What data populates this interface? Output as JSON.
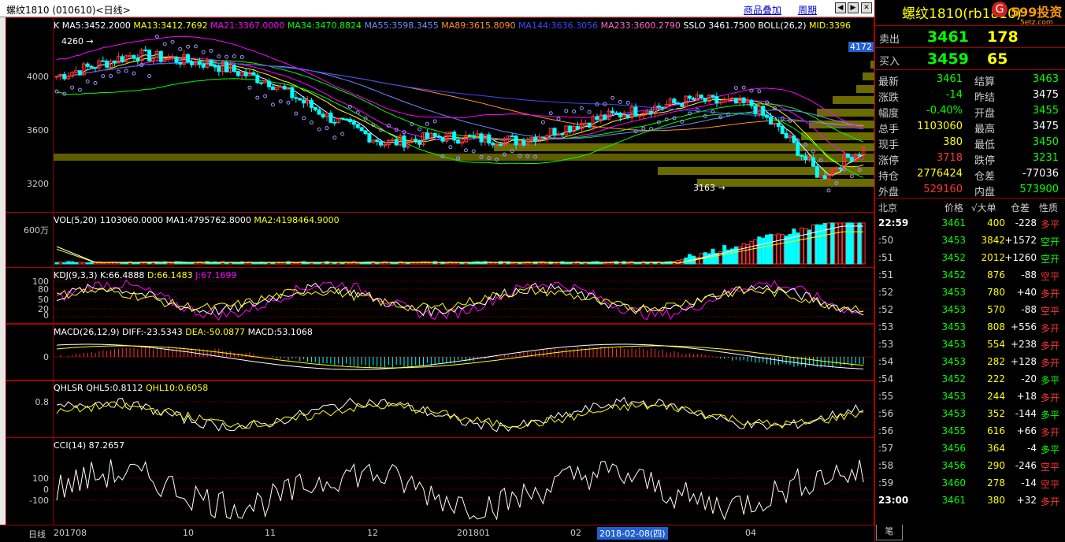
{
  "window": {
    "title": "螺纹1810 (010610)<日线>",
    "overlay_label": "商品叠加",
    "period_label": "周期"
  },
  "instrument": {
    "name": "螺纹1810(rb1810)",
    "brand": "599投资",
    "site": "5etz.com"
  },
  "quotes": [
    {
      "label": "卖出",
      "price": "3461",
      "volume": "178"
    },
    {
      "label": "买入",
      "price": "3459",
      "volume": "65"
    }
  ],
  "stats": [
    {
      "l1": "最新",
      "v1": "3461",
      "c1": "g",
      "l2": "结算",
      "v2": "3463",
      "c2": "g"
    },
    {
      "l1": "涨跌",
      "v1": "-14",
      "c1": "g",
      "l2": "昨结",
      "v2": "3475",
      "c2": "w"
    },
    {
      "l1": "幅度",
      "v1": "-0.40%",
      "c1": "g",
      "l2": "开盘",
      "v2": "3455",
      "c2": "g"
    },
    {
      "l1": "总手",
      "v1": "1103060",
      "c1": "y",
      "l2": "最高",
      "v2": "3475",
      "c2": "w"
    },
    {
      "l1": "现手",
      "v1": "380",
      "c1": "y",
      "l2": "最低",
      "v2": "3450",
      "c2": "g"
    },
    {
      "l1": "涨停",
      "v1": "3718",
      "c1": "r",
      "l2": "跌停",
      "v2": "3231",
      "c2": "g"
    },
    {
      "l1": "持仓",
      "v1": "2776424",
      "c1": "y",
      "l2": "仓差",
      "v2": "-77036",
      "c2": "w"
    },
    {
      "l1": "外盘",
      "v1": "529160",
      "c1": "r",
      "l2": "内盘",
      "v2": "573900",
      "c2": "g"
    }
  ],
  "ticks_header": {
    "time": "北京",
    "price": "价格",
    "vol": "√大单",
    "oi": "仓差",
    "nature": "性质"
  },
  "ticks": [
    {
      "t": "22:59",
      "p": "3461",
      "v": "400",
      "o": "-228",
      "n": "多平",
      "nc": "r",
      "oc": "w"
    },
    {
      "t": ":50",
      "p": "3453",
      "v": "3842",
      "o": "+1572",
      "n": "空开",
      "nc": "g",
      "oc": "w"
    },
    {
      "t": ":51",
      "p": "3452",
      "v": "2012",
      "o": "+1260",
      "n": "空开",
      "nc": "g",
      "oc": "w"
    },
    {
      "t": ":51",
      "p": "3452",
      "v": "876",
      "o": "-88",
      "n": "空平",
      "nc": "r",
      "oc": "w"
    },
    {
      "t": ":52",
      "p": "3453",
      "v": "780",
      "o": "+40",
      "n": "多开",
      "nc": "r",
      "oc": "w"
    },
    {
      "t": ":52",
      "p": "3453",
      "v": "570",
      "o": "-88",
      "n": "空平",
      "nc": "r",
      "oc": "w"
    },
    {
      "t": ":53",
      "p": "3453",
      "v": "808",
      "o": "+556",
      "n": "多开",
      "nc": "r",
      "oc": "w"
    },
    {
      "t": ":53",
      "p": "3453",
      "v": "554",
      "o": "+238",
      "n": "多开",
      "nc": "r",
      "oc": "w"
    },
    {
      "t": ":54",
      "p": "3453",
      "v": "282",
      "o": "+128",
      "n": "多开",
      "nc": "r",
      "oc": "w"
    },
    {
      "t": ":54",
      "p": "3452",
      "v": "222",
      "o": "-20",
      "n": "多平",
      "nc": "g",
      "oc": "w"
    },
    {
      "t": ":55",
      "p": "3453",
      "v": "244",
      "o": "+18",
      "n": "多开",
      "nc": "r",
      "oc": "w"
    },
    {
      "t": ":56",
      "p": "3453",
      "v": "352",
      "o": "-144",
      "n": "多平",
      "nc": "g",
      "oc": "w"
    },
    {
      "t": ":56",
      "p": "3455",
      "v": "616",
      "o": "+66",
      "n": "多开",
      "nc": "r",
      "oc": "w"
    },
    {
      "t": ":57",
      "p": "3456",
      "v": "364",
      "o": "-4",
      "n": "多平",
      "nc": "g",
      "oc": "w"
    },
    {
      "t": ":58",
      "p": "3456",
      "v": "290",
      "o": "-246",
      "n": "空平",
      "nc": "r",
      "oc": "w"
    },
    {
      "t": ":59",
      "p": "3460",
      "v": "278",
      "o": "-14",
      "n": "空平",
      "nc": "r",
      "oc": "w"
    },
    {
      "t": "23:00",
      "p": "3461",
      "v": "380",
      "o": "+32",
      "n": "多开",
      "nc": "r",
      "oc": "w"
    }
  ],
  "tick_tab": "笔",
  "panels": {
    "k": {
      "items": [
        {
          "text": "K",
          "color": "#ffffff"
        },
        {
          "text": "MA5:3452.2000",
          "color": "#ffffff"
        },
        {
          "text": "MA13:3412.7692",
          "color": "#ffff00"
        },
        {
          "text": "MA21:3367.0000",
          "color": "#ff00ff"
        },
        {
          "text": "MA34:3470.8824",
          "color": "#00ff00"
        },
        {
          "text": "MA55:3598.3455",
          "color": "#6a8cff"
        },
        {
          "text": "MA89:3615.8090",
          "color": "#ff8c32"
        },
        {
          "text": "MA144:3636.3056",
          "color": "#4444ff"
        },
        {
          "text": "MA233:3600.2790",
          "color": "#ff66cc"
        },
        {
          "text": "SSLO 3461.7500",
          "color": "#ffffff"
        },
        {
          "text": "BOLL(26,2)",
          "color": "#ffffff"
        },
        {
          "text": "MID:3396",
          "color": "#ffff00"
        }
      ],
      "yticks": [
        "4000",
        "3600",
        "3200"
      ],
      "high_label": "4260",
      "low_label": "3163",
      "price_tag": "4172"
    },
    "vol": {
      "label": "VOL(5,20) 1103060.0000",
      "ma1": "MA1:4795762.8000",
      "ma2": "MA2:4198464.9000",
      "ytick": "600万"
    },
    "kdj": {
      "label": "KDJ(9,3,3)",
      "k": "K:66.4888",
      "d": "D:66.1483",
      "j": "J:67.1699",
      "yticks": [
        "100",
        "80",
        "50",
        "20",
        "0"
      ]
    },
    "macd": {
      "label": "MACD(26,12,9)",
      "diff": "DIFF:-23.5343",
      "dea": "DEA:-50.0877",
      "macd": "MACD:53.1068",
      "ytick": "0"
    },
    "qhlsr": {
      "label": "QHLSR",
      "q5": "QHL5:0.8112",
      "q10": "QHL10:0.6058",
      "ytick": "0.8"
    },
    "cci": {
      "label": "CCI(14) 87.2657",
      "yticks": [
        "100",
        "0",
        "-100"
      ]
    }
  },
  "xaxis": {
    "mode": "日线",
    "labels": [
      "201708",
      "10",
      "11",
      "12",
      "201801",
      "02",
      "04"
    ],
    "cursor": "2018-02-08(四)"
  }
}
